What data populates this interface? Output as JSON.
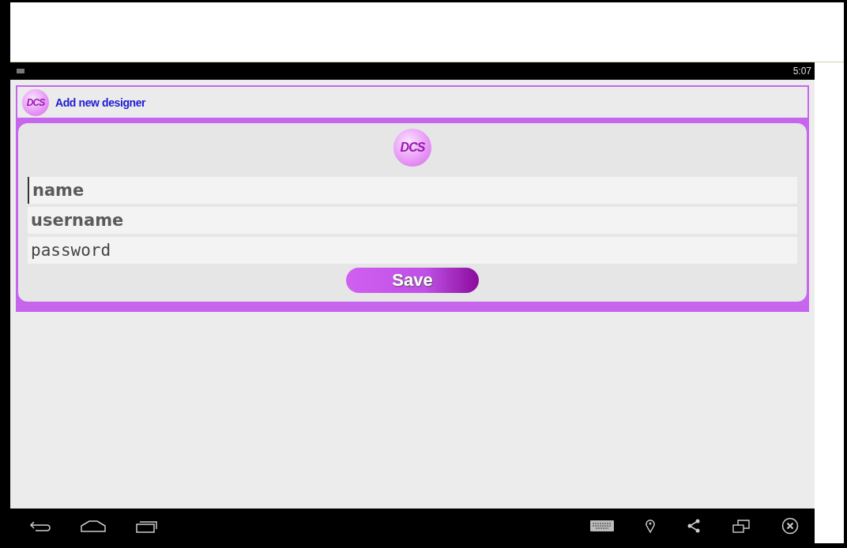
{
  "status_bar": {
    "time": "5:07"
  },
  "action_bar": {
    "logo_text": "DCS",
    "title": "Add new designer"
  },
  "form": {
    "logo_text": "DCS",
    "fields": [
      {
        "placeholder": "name",
        "focused": true,
        "kind": "text"
      },
      {
        "placeholder": "username",
        "focused": false,
        "kind": "text"
      },
      {
        "placeholder": "password",
        "focused": false,
        "kind": "password"
      }
    ],
    "save_button": "Save"
  }
}
